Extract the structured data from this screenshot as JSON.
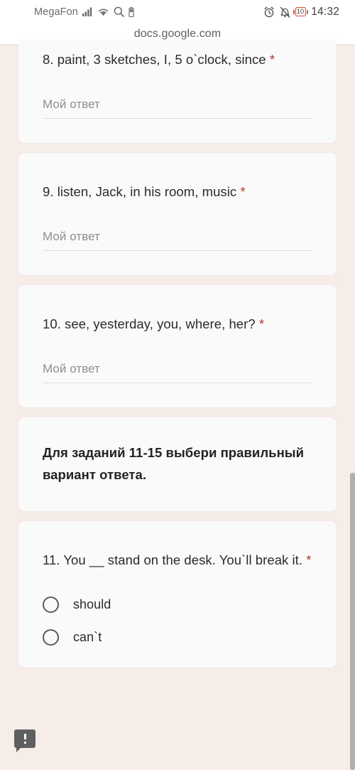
{
  "status_bar": {
    "carrier": "MegaFon",
    "signal_icon": "signal-bars-icon",
    "wifi_icon": "wifi-icon",
    "search_icon": "search-icon",
    "small_battery_icon": "battery-icon",
    "alarm_icon": "alarm-clock-icon",
    "mute_icon": "bell-muted-icon",
    "battery_percent": "10",
    "battery_color": "#d94b3a",
    "time": "14:32"
  },
  "browser": {
    "url": "docs.google.com"
  },
  "form": {
    "answer_placeholder": "Мой ответ",
    "required_marker": "*",
    "required_color": "#b23c2e",
    "questions": [
      {
        "id": "q8",
        "text": "8. paint, 3 sketches, I, 5 o`clock, since",
        "required": true,
        "type": "short-answer"
      },
      {
        "id": "q9",
        "text": "9. listen, Jack, in his room, music",
        "required": true,
        "type": "short-answer"
      },
      {
        "id": "q10",
        "text": "10. see, yesterday, you, where, her?",
        "required": true,
        "type": "short-answer"
      }
    ],
    "instruction": "Для заданий 11-15 выбери правильный вариант ответа.",
    "question11": {
      "id": "q11",
      "text": "11. You __ stand on the desk. You`ll break it.",
      "required": true,
      "type": "multiple-choice",
      "options": [
        {
          "label": "should",
          "selected": false
        },
        {
          "label": "can`t",
          "selected": false
        }
      ]
    }
  },
  "overlay": {
    "comment_badge_icon": "comment-alert-icon"
  },
  "theme": {
    "page_background": "#f6ece8",
    "card_background": "#fbfafa",
    "text_color": "#2b2b2b",
    "placeholder_color": "#8e8e8e",
    "scrollbar_color": "#b5aeac"
  }
}
